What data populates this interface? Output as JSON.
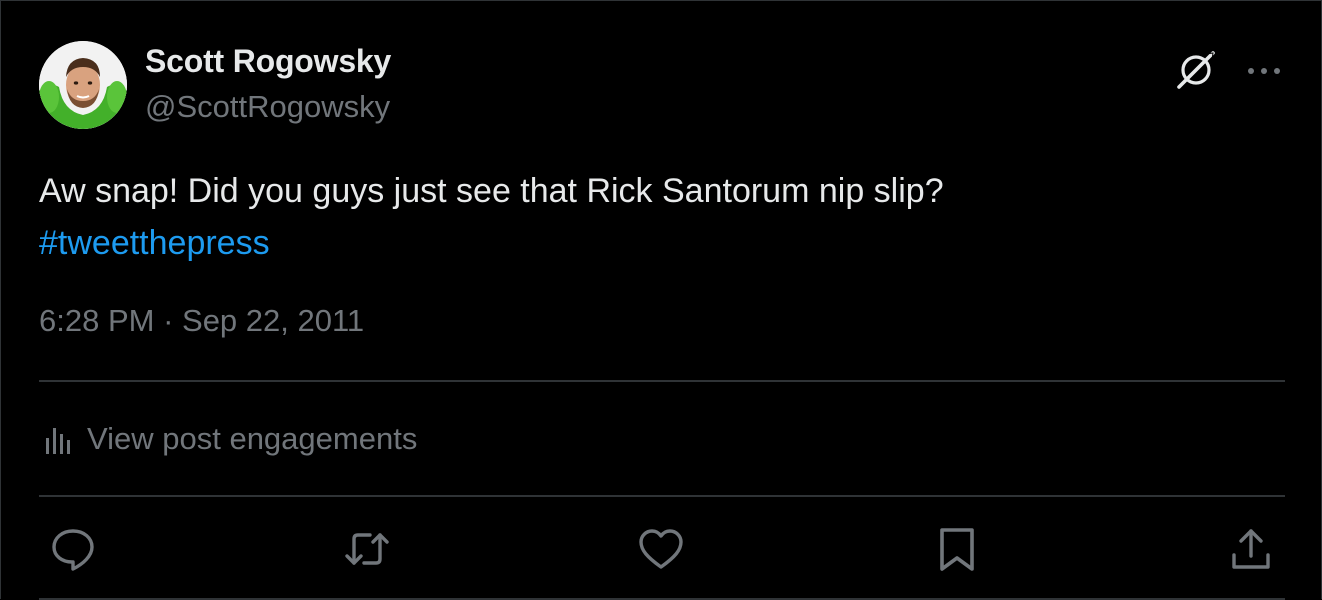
{
  "author": {
    "display_name": "Scott Rogowsky",
    "handle": "@ScottRogowsky",
    "avatar_icon": "profile-photo"
  },
  "tweet": {
    "text": "Aw snap! Did you guys just see that Rick Santorum nip slip?",
    "hashtag": "#tweetthepress"
  },
  "meta": {
    "time": "6:28 PM",
    "separator": " · ",
    "date": "Sep 22, 2011"
  },
  "engagements": {
    "label": "View post engagements",
    "icon": "analytics-bars-icon"
  },
  "actions": {
    "icons": [
      "reply-icon",
      "repost-icon",
      "like-icon",
      "bookmark-icon",
      "share-icon"
    ]
  },
  "header_icons": [
    "grok-icon",
    "more-icon"
  ],
  "colors": {
    "background": "#000000",
    "primary_text": "#e7e9ea",
    "secondary_text": "#71767b",
    "link": "#1d9bf0",
    "divider": "#2f3336"
  }
}
